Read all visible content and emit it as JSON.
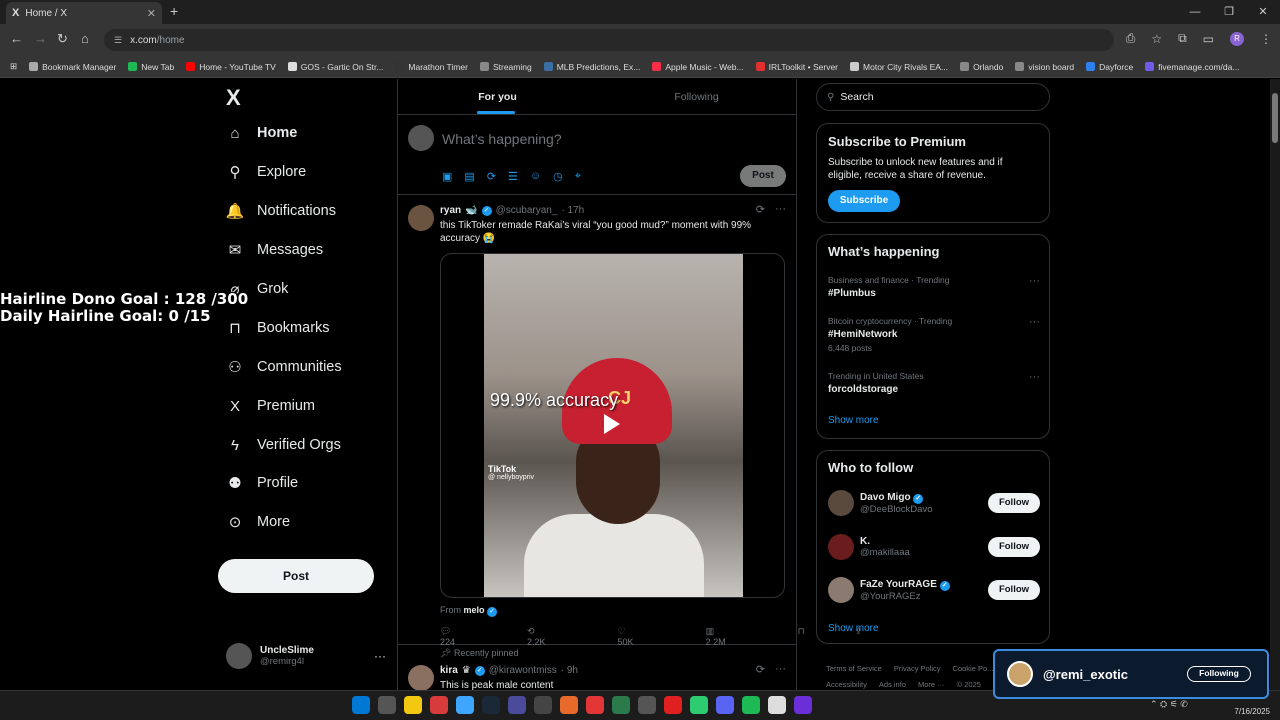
{
  "browser": {
    "tab_title": "Home / X",
    "tab_logo": "X",
    "url_host": "x.com",
    "url_path": "/home",
    "bookmarks": [
      {
        "label": "Bookmark Manager",
        "color": "#aaaaaa"
      },
      {
        "label": "New Tab",
        "color": "#1db954"
      },
      {
        "label": "Home - YouTube TV",
        "color": "#ff0000"
      },
      {
        "label": "GOS - Gartic On Str...",
        "color": "#dddddd"
      },
      {
        "label": "Marathon Timer",
        "color": "#333333"
      },
      {
        "label": "Streaming",
        "color": "#888888"
      },
      {
        "label": "MLB Predictions, Ex...",
        "color": "#3b6ea5"
      },
      {
        "label": "Apple Music - Web...",
        "color": "#fa2d48"
      },
      {
        "label": "IRLToolkit • Server",
        "color": "#e03030"
      },
      {
        "label": "Motor City Rivals EA...",
        "color": "#cccccc"
      },
      {
        "label": "Orlando",
        "color": "#888888"
      },
      {
        "label": "vision board",
        "color": "#888888"
      },
      {
        "label": "Dayforce",
        "color": "#2f80ed"
      },
      {
        "label": "fivemanage.com/da...",
        "color": "#6c5ce7"
      }
    ],
    "profile_initial": "R"
  },
  "overlay": {
    "line1": "Hairline Dono Goal : 128 /300",
    "line2": "Daily Hairline Goal: 0  /15"
  },
  "nav": {
    "logo": "X",
    "items": [
      {
        "label": "Home",
        "icon": "⌂"
      },
      {
        "label": "Explore",
        "icon": "⚲"
      },
      {
        "label": "Notifications",
        "icon": "🔔"
      },
      {
        "label": "Messages",
        "icon": "✉"
      },
      {
        "label": "Grok",
        "icon": "⌀"
      },
      {
        "label": "Bookmarks",
        "icon": "⊓"
      },
      {
        "label": "Communities",
        "icon": "⚇"
      },
      {
        "label": "Premium",
        "icon": "X"
      },
      {
        "label": "Verified Orgs",
        "icon": "ϟ"
      },
      {
        "label": "Profile",
        "icon": "⚉"
      },
      {
        "label": "More",
        "icon": "⊙"
      }
    ],
    "post_label": "Post",
    "account_name": "UncleSlime",
    "account_handle": "@remirg4l"
  },
  "feed": {
    "tab_for_you": "For you",
    "tab_following": "Following",
    "compose_placeholder": "What’s happening?",
    "compose_post": "Post",
    "tweet1": {
      "name": "ryan",
      "emoji": "🐋",
      "handle": "@scubaryan_",
      "time": "· 17h",
      "text": "this TikToker remade RaKai’s viral “you good mud?” moment with 99% accuracy 😭",
      "video_caption": "99.9% accuracy",
      "helmet_text": "CJ",
      "tiktok_label": "TikTok",
      "tiktok_user": "@ nellyboypriv",
      "from_label": "From",
      "from_name": "melo",
      "replies": "224",
      "reposts": "2.2K",
      "likes": "50K",
      "views": "2.2M"
    },
    "tweet2": {
      "pinned_label": "Recently pinned",
      "name": "kira",
      "handle": "@kirawontmiss",
      "time": "· 9h",
      "text": "This is peak male content"
    }
  },
  "right": {
    "search_placeholder": "Search",
    "premium": {
      "title": "Subscribe to Premium",
      "text": "Subscribe to unlock new features and if eligible, receive a share of revenue.",
      "button": "Subscribe"
    },
    "happening": {
      "title": "What’s happening",
      "trends": [
        {
          "category": "Business and finance · Trending",
          "topic": "#Plumbus",
          "count": ""
        },
        {
          "category": "Bitcoin cryptocurrency · Trending",
          "topic": "#HemiNetwork",
          "count": "6,448 posts"
        },
        {
          "category": "Trending in United States",
          "topic": "forcoldstorage",
          "count": ""
        }
      ],
      "show_more": "Show more"
    },
    "who_to_follow": {
      "title": "Who to follow",
      "accounts": [
        {
          "name": "Davo Migo",
          "handle": "@DeeBlockDavo",
          "avatar_color": "#5a4a3e",
          "button": "Follow"
        },
        {
          "name": "K.",
          "handle": "@makillaaa",
          "avatar_color": "#6b1d1d",
          "button": "Follow"
        },
        {
          "name": "FaZe YourRAGE",
          "handle": "@YourRAGEz",
          "avatar_color": "#8a7a70",
          "button": "Follow"
        }
      ],
      "show_more": "Show more"
    },
    "footer": [
      "Terms of Service",
      "Privacy Policy",
      "Cookie Po...",
      "Accessibility",
      "Ads info",
      "More ···",
      "© 2025"
    ]
  },
  "alert": {
    "name": "@remi_exotic",
    "button": "Following"
  },
  "taskbar": {
    "icon_colors": [
      "#0078d4",
      "#555555",
      "#f2c811",
      "#d83b3b",
      "#3ea6ff",
      "#1b2838",
      "#4b4b9b",
      "#444444",
      "#e86a2b",
      "#e23636",
      "#2b7a4b",
      "#555555",
      "#e02020",
      "#2ecc71",
      "#5865f2",
      "#1db954",
      "#dddddd",
      "#6a2fd6"
    ],
    "date": "7/16/2025"
  }
}
